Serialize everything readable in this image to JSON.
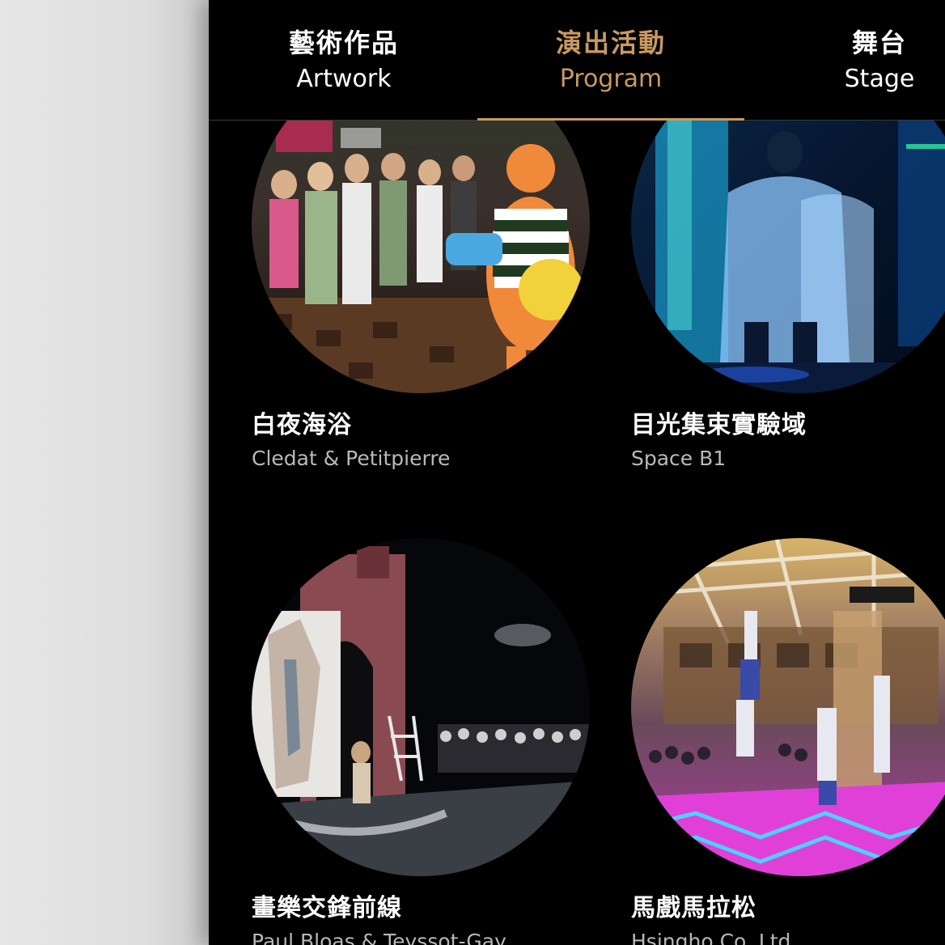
{
  "tabs": [
    {
      "zh": "藝術作品",
      "en": "Artwork",
      "active": false
    },
    {
      "zh": "演出活動",
      "en": "Program",
      "active": true
    },
    {
      "zh": "舞台",
      "en": "Stage",
      "active": false
    }
  ],
  "accent_color": "#c99a60",
  "programs": [
    {
      "title": "白夜海浴",
      "subtitle": "Cledat & Petitpierre"
    },
    {
      "title": "目光集束實驗域",
      "subtitle": "Space B1"
    },
    {
      "title": "畫樂交鋒前線",
      "subtitle": "Paul Bloas & Teyssot-Gay"
    },
    {
      "title": "馬戲馬拉松",
      "subtitle": "Hsingho Co. Ltd."
    }
  ]
}
